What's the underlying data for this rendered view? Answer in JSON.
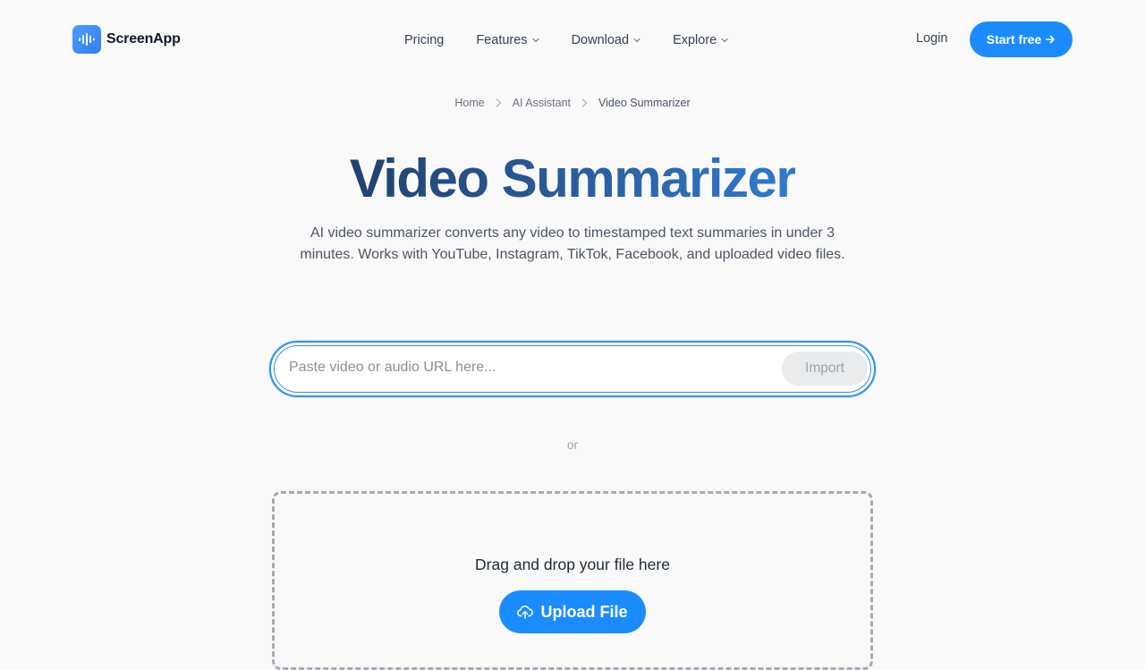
{
  "brand": {
    "name": "ScreenApp",
    "accent_color": "#1a8cff",
    "logo_icon": "soundwave-icon"
  },
  "nav": {
    "links": [
      {
        "label": "Pricing",
        "has_dropdown": false
      },
      {
        "label": "Features",
        "has_dropdown": true
      },
      {
        "label": "Download",
        "has_dropdown": true
      },
      {
        "label": "Explore",
        "has_dropdown": true
      }
    ],
    "login_label": "Login",
    "cta_label": "Start free",
    "cta_icon": "arrow-right-icon"
  },
  "breadcrumb": {
    "items": [
      "Home",
      "AI Assistant",
      "Video Summarizer"
    ]
  },
  "hero": {
    "title": "Video Summarizer",
    "subtitle": "AI video summarizer converts any video to timestamped text summaries in under 3 minutes. Works with YouTube, Instagram, TikTok, Facebook, and uploaded video files."
  },
  "url_import": {
    "value": "",
    "placeholder": "Paste video or audio URL here...",
    "button_label": "Import"
  },
  "divider_text": "or",
  "dropzone": {
    "prompt": "Drag and drop your file here",
    "upload_label": "Upload File",
    "upload_icon": "cloud-upload-icon"
  }
}
